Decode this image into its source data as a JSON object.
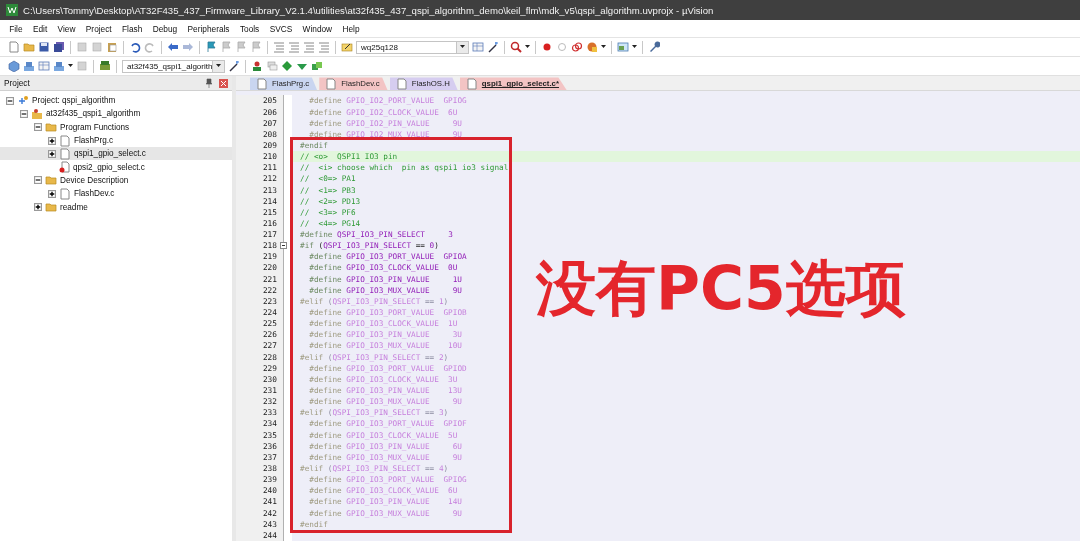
{
  "window": {
    "title": "C:\\Users\\Tommy\\Desktop\\AT32F435_437_Firmware_Library_V2.1.4\\utilities\\at32f435_437_qspi_algorithm_demo\\keil_flm\\mdk_v5\\qspi_algorithm.uvprojx - µVision"
  },
  "menu": [
    "File",
    "Edit",
    "View",
    "Project",
    "Flash",
    "Debug",
    "Peripherals",
    "Tools",
    "SVCS",
    "Window",
    "Help"
  ],
  "toolbar": {
    "find_combo": "wq25q128",
    "target_combo": "at32f435_qspi1_algorith"
  },
  "project_panel": {
    "title": "Project",
    "tree": [
      {
        "label": "Project: qspi_algorithm",
        "kind": "project",
        "expanded": true,
        "selected": false,
        "children": [
          {
            "label": "at32f435_qspi1_algorithm",
            "kind": "target",
            "expanded": true,
            "selected": false,
            "children": [
              {
                "label": "Program Functions",
                "kind": "group",
                "expanded": true,
                "selected": false,
                "children": [
                  {
                    "label": "FlashPrg.c",
                    "kind": "file",
                    "expanded": false,
                    "selected": false
                  },
                  {
                    "label": "qspi1_gpio_select.c",
                    "kind": "file",
                    "expanded": false,
                    "selected": true
                  },
                  {
                    "label": "qpsi2_gpio_select.c",
                    "kind": "excluded-file",
                    "selected": false
                  }
                ]
              },
              {
                "label": "Device Description",
                "kind": "group",
                "expanded": true,
                "selected": false,
                "children": [
                  {
                    "label": "FlashDev.c",
                    "kind": "file",
                    "expanded": false,
                    "selected": false
                  }
                ]
              },
              {
                "label": "readme",
                "kind": "group",
                "expanded": false,
                "selected": false
              }
            ]
          }
        ]
      }
    ]
  },
  "tabs": [
    {
      "label": "FlashPrg.c",
      "color": "#c9d5f0",
      "selected": false
    },
    {
      "label": "FlashDev.c",
      "color": "#f3c4c4",
      "selected": false
    },
    {
      "label": "FlashOS.H",
      "color": "#d6cdf0",
      "selected": false
    },
    {
      "label": "qspi1_gpio_select.c*",
      "color": "#f3c4c4",
      "selected": true
    }
  ],
  "code": {
    "lines_before": [
      {
        "number": "205",
        "inactive": true,
        "current": false,
        "parts": [
          {
            "text": "  #define",
            "kind": "directive"
          },
          {
            "text": " GPIO_IO2_PORT_VALUE",
            "kind": "macro"
          },
          {
            "text": "  GPIOG",
            "kind": "value"
          }
        ]
      },
      {
        "number": "206",
        "inactive": true,
        "current": false,
        "parts": [
          {
            "text": "  #define",
            "kind": "directive"
          },
          {
            "text": " GPIO_IO2_CLOCK_VALUE",
            "kind": "macro"
          },
          {
            "text": "  6U",
            "kind": "value"
          }
        ]
      },
      {
        "number": "207",
        "inactive": true,
        "current": false,
        "parts": [
          {
            "text": "  #define",
            "kind": "directive"
          },
          {
            "text": " GPIO_IO2_PIN_VALUE",
            "kind": "macro"
          },
          {
            "text": "     9U",
            "kind": "value"
          }
        ]
      },
      {
        "number": "208",
        "inactive": true,
        "current": false,
        "parts": [
          {
            "text": "  #define",
            "kind": "directive"
          },
          {
            "text": " GPIO_IO2_MUX_VALUE",
            "kind": "macro"
          },
          {
            "text": "     9U",
            "kind": "value"
          }
        ]
      }
    ],
    "callout_lines": [
      {
        "number": "209",
        "inactive": false,
        "current": false,
        "parts": [
          {
            "text": "#endif",
            "kind": "directive"
          }
        ]
      },
      {
        "number": "210",
        "inactive": false,
        "current": true,
        "parts": [
          {
            "text": "// <o>  QSPI1 IO3 pin",
            "kind": "comment"
          }
        ]
      },
      {
        "number": "211",
        "inactive": false,
        "current": false,
        "parts": [
          {
            "text": "//  <i> choose which  pin as qspi1 io3 signal",
            "kind": "comment"
          }
        ]
      },
      {
        "number": "212",
        "inactive": false,
        "current": false,
        "parts": [
          {
            "text": "//  <0=> PA1",
            "kind": "comment"
          }
        ]
      },
      {
        "number": "213",
        "inactive": false,
        "current": false,
        "parts": [
          {
            "text": "//  <1=> PB3",
            "kind": "comment"
          }
        ]
      },
      {
        "number": "214",
        "inactive": false,
        "current": false,
        "parts": [
          {
            "text": "//  <2=> PD13",
            "kind": "comment"
          }
        ]
      },
      {
        "number": "215",
        "inactive": false,
        "current": false,
        "parts": [
          {
            "text": "//  <3=> PF6",
            "kind": "comment"
          }
        ]
      },
      {
        "number": "216",
        "inactive": false,
        "current": false,
        "parts": [
          {
            "text": "//  <4=> PG14",
            "kind": "comment"
          }
        ]
      },
      {
        "number": "217",
        "inactive": false,
        "current": false,
        "parts": [
          {
            "text": "#define",
            "kind": "directive"
          },
          {
            "text": " QSPI_IO3_PIN_SELECT",
            "kind": "macro"
          },
          {
            "text": "     3",
            "kind": "value"
          }
        ]
      },
      {
        "number": "218",
        "inactive": false,
        "current": false,
        "fold_start": true,
        "parts": [
          {
            "text": "#if",
            "kind": "directive"
          },
          {
            "text": " (",
            "kind": "plain"
          },
          {
            "text": "QSPI_IO3_PIN_SELECT",
            "kind": "macro"
          },
          {
            "text": " == ",
            "kind": "plain"
          },
          {
            "text": "0",
            "kind": "value"
          },
          {
            "text": ")",
            "kind": "plain"
          }
        ]
      },
      {
        "number": "219",
        "inactive": false,
        "current": false,
        "parts": [
          {
            "text": "  #define",
            "kind": "directive"
          },
          {
            "text": " GPIO_IO3_PORT_VALUE",
            "kind": "macro"
          },
          {
            "text": "  GPIOA",
            "kind": "value"
          }
        ]
      },
      {
        "number": "220",
        "inactive": false,
        "current": false,
        "parts": [
          {
            "text": "  #define",
            "kind": "directive"
          },
          {
            "text": " GPIO_IO3_CLOCK_VALUE",
            "kind": "macro"
          },
          {
            "text": "  0U",
            "kind": "value"
          }
        ]
      },
      {
        "number": "221",
        "inactive": false,
        "current": false,
        "parts": [
          {
            "text": "  #define",
            "kind": "directive"
          },
          {
            "text": " GPIO_IO3_PIN_VALUE",
            "kind": "macro"
          },
          {
            "text": "     1U",
            "kind": "value"
          }
        ]
      },
      {
        "number": "222",
        "inactive": false,
        "current": false,
        "parts": [
          {
            "text": "  #define",
            "kind": "directive"
          },
          {
            "text": " GPIO_IO3_MUX_VALUE",
            "kind": "macro"
          },
          {
            "text": "     9U",
            "kind": "value"
          }
        ]
      },
      {
        "number": "223",
        "inactive": true,
        "current": false,
        "parts": [
          {
            "text": "#elif",
            "kind": "directive"
          },
          {
            "text": " (",
            "kind": "plain"
          },
          {
            "text": "QSPI_IO3_PIN_SELECT",
            "kind": "macro"
          },
          {
            "text": " == ",
            "kind": "plain"
          },
          {
            "text": "1",
            "kind": "value"
          },
          {
            "text": ")",
            "kind": "plain"
          }
        ]
      },
      {
        "number": "224",
        "inactive": true,
        "current": false,
        "parts": [
          {
            "text": "  #define",
            "kind": "directive"
          },
          {
            "text": " GPIO_IO3_PORT_VALUE",
            "kind": "macro"
          },
          {
            "text": "  GPIOB",
            "kind": "value"
          }
        ]
      },
      {
        "number": "225",
        "inactive": true,
        "current": false,
        "parts": [
          {
            "text": "  #define",
            "kind": "directive"
          },
          {
            "text": " GPIO_IO3_CLOCK_VALUE",
            "kind": "macro"
          },
          {
            "text": "  1U",
            "kind": "value"
          }
        ]
      },
      {
        "number": "226",
        "inactive": true,
        "current": false,
        "parts": [
          {
            "text": "  #define",
            "kind": "directive"
          },
          {
            "text": " GPIO_IO3_PIN_VALUE",
            "kind": "macro"
          },
          {
            "text": "     3U",
            "kind": "value"
          }
        ]
      },
      {
        "number": "227",
        "inactive": true,
        "current": false,
        "parts": [
          {
            "text": "  #define",
            "kind": "directive"
          },
          {
            "text": " GPIO_IO3_MUX_VALUE",
            "kind": "macro"
          },
          {
            "text": "    10U",
            "kind": "value"
          }
        ]
      },
      {
        "number": "228",
        "inactive": true,
        "current": false,
        "parts": [
          {
            "text": "#elif",
            "kind": "directive"
          },
          {
            "text": " (",
            "kind": "plain"
          },
          {
            "text": "QSPI_IO3_PIN_SELECT",
            "kind": "macro"
          },
          {
            "text": " == ",
            "kind": "plain"
          },
          {
            "text": "2",
            "kind": "value"
          },
          {
            "text": ")",
            "kind": "plain"
          }
        ]
      },
      {
        "number": "229",
        "inactive": true,
        "current": false,
        "parts": [
          {
            "text": "  #define",
            "kind": "directive"
          },
          {
            "text": " GPIO_IO3_PORT_VALUE",
            "kind": "macro"
          },
          {
            "text": "  GPIOD",
            "kind": "value"
          }
        ]
      },
      {
        "number": "230",
        "inactive": true,
        "current": false,
        "parts": [
          {
            "text": "  #define",
            "kind": "directive"
          },
          {
            "text": " GPIO_IO3_CLOCK_VALUE",
            "kind": "macro"
          },
          {
            "text": "  3U",
            "kind": "value"
          }
        ]
      },
      {
        "number": "231",
        "inactive": true,
        "current": false,
        "parts": [
          {
            "text": "  #define",
            "kind": "directive"
          },
          {
            "text": " GPIO_IO3_PIN_VALUE",
            "kind": "macro"
          },
          {
            "text": "    13U",
            "kind": "value"
          }
        ]
      },
      {
        "number": "232",
        "inactive": true,
        "current": false,
        "parts": [
          {
            "text": "  #define",
            "kind": "directive"
          },
          {
            "text": " GPIO_IO3_MUX_VALUE",
            "kind": "macro"
          },
          {
            "text": "     9U",
            "kind": "value"
          }
        ]
      },
      {
        "number": "233",
        "inactive": true,
        "current": false,
        "parts": [
          {
            "text": "#elif",
            "kind": "directive"
          },
          {
            "text": " (",
            "kind": "plain"
          },
          {
            "text": "QSPI_IO3_PIN_SELECT",
            "kind": "macro"
          },
          {
            "text": " == ",
            "kind": "plain"
          },
          {
            "text": "3",
            "kind": "value"
          },
          {
            "text": ")",
            "kind": "plain"
          }
        ]
      },
      {
        "number": "234",
        "inactive": true,
        "current": false,
        "parts": [
          {
            "text": "  #define",
            "kind": "directive"
          },
          {
            "text": " GPIO_IO3_PORT_VALUE",
            "kind": "macro"
          },
          {
            "text": "  GPIOF",
            "kind": "value"
          }
        ]
      },
      {
        "number": "235",
        "inactive": true,
        "current": false,
        "parts": [
          {
            "text": "  #define",
            "kind": "directive"
          },
          {
            "text": " GPIO_IO3_CLOCK_VALUE",
            "kind": "macro"
          },
          {
            "text": "  5U",
            "kind": "value"
          }
        ]
      },
      {
        "number": "236",
        "inactive": true,
        "current": false,
        "parts": [
          {
            "text": "  #define",
            "kind": "directive"
          },
          {
            "text": " GPIO_IO3_PIN_VALUE",
            "kind": "macro"
          },
          {
            "text": "     6U",
            "kind": "value"
          }
        ]
      },
      {
        "number": "237",
        "inactive": true,
        "current": false,
        "parts": [
          {
            "text": "  #define",
            "kind": "directive"
          },
          {
            "text": " GPIO_IO3_MUX_VALUE",
            "kind": "macro"
          },
          {
            "text": "     9U",
            "kind": "value"
          }
        ]
      },
      {
        "number": "238",
        "inactive": true,
        "current": false,
        "parts": [
          {
            "text": "#elif",
            "kind": "directive"
          },
          {
            "text": " (",
            "kind": "plain"
          },
          {
            "text": "QSPI_IO3_PIN_SELECT",
            "kind": "macro"
          },
          {
            "text": " == ",
            "kind": "plain"
          },
          {
            "text": "4",
            "kind": "value"
          },
          {
            "text": ")",
            "kind": "plain"
          }
        ]
      },
      {
        "number": "239",
        "inactive": true,
        "current": false,
        "parts": [
          {
            "text": "  #define",
            "kind": "directive"
          },
          {
            "text": " GPIO_IO3_PORT_VALUE",
            "kind": "macro"
          },
          {
            "text": "  GPIOG",
            "kind": "value"
          }
        ]
      },
      {
        "number": "240",
        "inactive": true,
        "current": false,
        "parts": [
          {
            "text": "  #define",
            "kind": "directive"
          },
          {
            "text": " GPIO_IO3_CLOCK_VALUE",
            "kind": "macro"
          },
          {
            "text": "  6U",
            "kind": "value"
          }
        ]
      },
      {
        "number": "241",
        "inactive": true,
        "current": false,
        "parts": [
          {
            "text": "  #define",
            "kind": "directive"
          },
          {
            "text": " GPIO_IO3_PIN_VALUE",
            "kind": "macro"
          },
          {
            "text": "    14U",
            "kind": "value"
          }
        ]
      },
      {
        "number": "242",
        "inactive": true,
        "current": false,
        "parts": [
          {
            "text": "  #define",
            "kind": "directive"
          },
          {
            "text": " GPIO_IO3_MUX_VALUE",
            "kind": "macro"
          },
          {
            "text": "     9U",
            "kind": "value"
          }
        ]
      },
      {
        "number": "243",
        "inactive": true,
        "current": false,
        "parts": [
          {
            "text": "#endif",
            "kind": "directive"
          }
        ]
      }
    ],
    "lines_after": [
      {
        "number": "244"
      }
    ]
  },
  "callout": {
    "text": "没有PC5选项"
  }
}
